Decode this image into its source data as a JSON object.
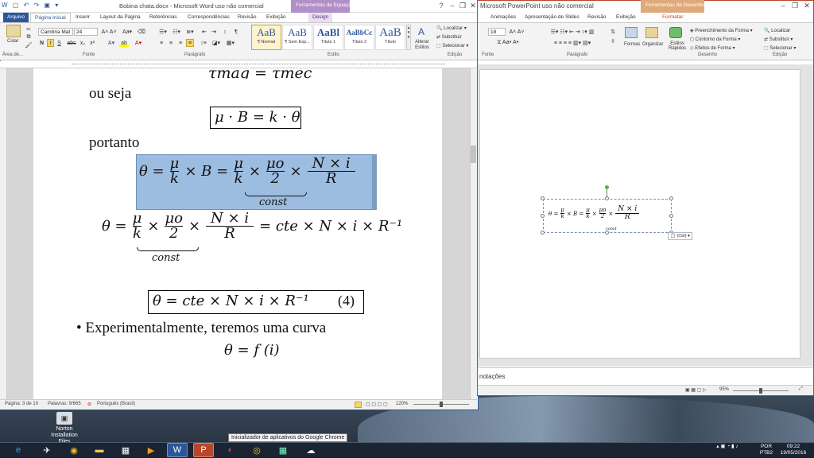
{
  "word": {
    "qat": "W ▢ ↶ ↷ ▣ ▾",
    "title": "Bobina chata.docx - Microsoft Word uso não comercial",
    "context_tool": "Ferramentas de Equação",
    "context_tab": "Design",
    "tabs": [
      "Arquivo",
      "Página Inicial",
      "Inserir",
      "Layout da Página",
      "Referências",
      "Correspondências",
      "Revisão",
      "Exibição"
    ],
    "ribbon": {
      "paste": "Colar",
      "clipboard_group": "Área de...",
      "font_name": "Cambria Mat",
      "font_size": "24",
      "font_group": "Fonte",
      "paragraph_group": "Parágrafo",
      "styles": [
        {
          "preview": "AaB",
          "name": "¶ Normal"
        },
        {
          "preview": "AaB",
          "name": "¶ Sem Esp..."
        },
        {
          "preview": "AaBl",
          "name": "Título 1"
        },
        {
          "preview": "AaBbCc",
          "name": "Título 2"
        },
        {
          "preview": "AaB",
          "name": "Título"
        }
      ],
      "change_styles": "Alterar Estilos",
      "style_group": "Estilo",
      "find": "Localizar",
      "replace": "Substituir",
      "select": "Selecionar",
      "edit_group": "Edição"
    },
    "doc": {
      "top_eq_partial": "τmag = τmec",
      "line1": "ou seja",
      "eq1": "μ · B = k · θ",
      "line2": "portanto",
      "eq2_theta": "θ =",
      "eq2_mu": "μ",
      "eq2_k": "k",
      "eq2_times_b": "× B =",
      "eq2_muo": "μo",
      "eq2_two": "2",
      "eq2_times": "×",
      "eq2_ni": "N × i",
      "eq2_r": "R",
      "eq2_const": "const",
      "eq3_theta": "θ =",
      "eq3_tail": "= cte × N × i × R⁻¹",
      "eq3_const": "const",
      "eq4": "θ = cte × N × i × R⁻¹",
      "eq4_num": "(4)",
      "bullet": "Experimentalmente, teremos uma curva",
      "eq5": "θ = f (i)"
    },
    "status": {
      "page": "Página: 3 de 10",
      "words": "Palavras: 9/665",
      "lang": "Português (Brasil)",
      "zoom": "120%"
    }
  },
  "ppt": {
    "title": "Microsoft PowerPoint uso não comercial",
    "context_tool": "Ferramentas de Desenho",
    "tabs": [
      "Animações",
      "Apresentação de Slides",
      "Revisão",
      "Exibição",
      "Formatar"
    ],
    "ribbon": {
      "font_size": "18",
      "font_group": "Fonte",
      "paragraph_group": "Parágrafo",
      "shapes": "Formas",
      "arrange": "Organizar",
      "quick_styles": "Estilos Rápidos",
      "fill": "Preenchimento da Forma",
      "outline": "Contorno da Forma",
      "effects": "Efeitos de Forma",
      "drawing_group": "Desenho",
      "find": "Localizar",
      "replace": "Substituir",
      "select": "Selecionar",
      "edit_group": "Edição"
    },
    "paste_tag": "(Ctrl)",
    "notes": "notações",
    "zoom": "95%"
  },
  "desktop": {
    "norton_label": "Norton Installation Files",
    "tooltip": "Inicializador de aplicativos do Google Chrome",
    "lang": "POR",
    "layout": "PTB2",
    "time": "09:22",
    "date": "19/05/2016"
  }
}
